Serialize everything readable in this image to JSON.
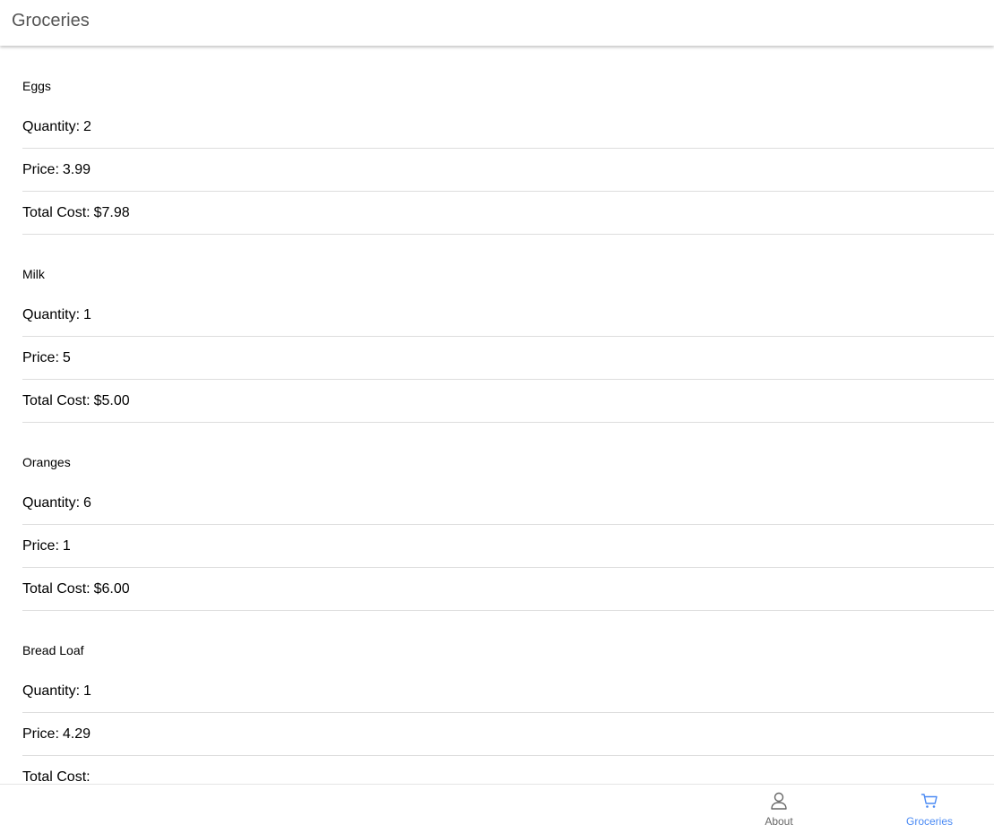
{
  "header": {
    "title": "Groceries"
  },
  "groceries": [
    {
      "name": "Eggs",
      "quantity_label": "Quantity:",
      "quantity": "2",
      "price_label": "Price:",
      "price": "3.99",
      "total_label": "Total Cost:",
      "total": "$7.98"
    },
    {
      "name": "Milk",
      "quantity_label": "Quantity:",
      "quantity": "1",
      "price_label": "Price:",
      "price": "5",
      "total_label": "Total Cost:",
      "total": "$5.00"
    },
    {
      "name": "Oranges",
      "quantity_label": "Quantity:",
      "quantity": "6",
      "price_label": "Price:",
      "price": "1",
      "total_label": "Total Cost:",
      "total": "$6.00"
    },
    {
      "name": "Bread Loaf",
      "quantity_label": "Quantity:",
      "quantity": "1",
      "price_label": "Price:",
      "price": "4.29",
      "total_label": "Total Cost:",
      "total": ""
    }
  ],
  "tabbar": {
    "tabs": [
      {
        "label": "About",
        "icon": "person-icon",
        "active": false,
        "color": "#666666"
      },
      {
        "label": "Groceries",
        "icon": "cart-icon",
        "active": true,
        "color": "#4a8af4"
      }
    ]
  }
}
